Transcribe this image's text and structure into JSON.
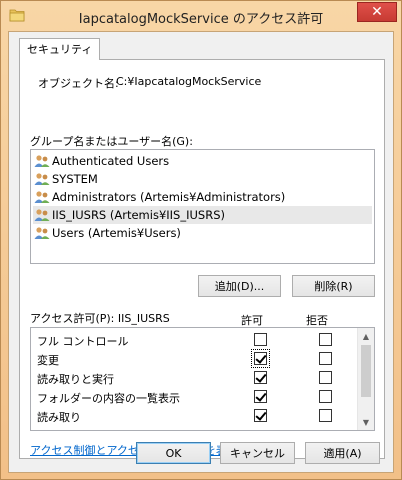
{
  "window": {
    "title": "IapcatalogMockService のアクセス許可",
    "close_label": "✕"
  },
  "tab": {
    "label": "セキュリティ"
  },
  "object": {
    "label": "オブジェクト名:",
    "value": "C:¥IapcatalogMockService"
  },
  "groups": {
    "label": "グループ名またはユーザー名(G):",
    "items": [
      {
        "label": "Authenticated Users",
        "selected": false
      },
      {
        "label": "SYSTEM",
        "selected": false
      },
      {
        "label": "Administrators (Artemis¥Administrators)",
        "selected": false
      },
      {
        "label": "IIS_IUSRS (Artemis¥IIS_IUSRS)",
        "selected": true
      },
      {
        "label": "Users (Artemis¥Users)",
        "selected": false
      }
    ],
    "add_label": "追加(D)...",
    "remove_label": "削除(R)"
  },
  "permissions": {
    "label": "アクセス許可(P): IIS_IUSRS",
    "allow_header": "許可",
    "deny_header": "拒否",
    "rows": [
      {
        "name": "フル コントロール",
        "allow": false,
        "deny": false
      },
      {
        "name": "変更",
        "allow": true,
        "deny": false,
        "focus": true
      },
      {
        "name": "読み取りと実行",
        "allow": true,
        "deny": false
      },
      {
        "name": "フォルダーの内容の一覧表示",
        "allow": true,
        "deny": false
      },
      {
        "name": "読み取り",
        "allow": true,
        "deny": false
      }
    ]
  },
  "link": {
    "label": "アクセス制御とアクセス許可の詳細を表示します。"
  },
  "footer": {
    "ok_label": "OK",
    "cancel_label": "キャンセル",
    "apply_label": "適用(A)"
  },
  "colors": {
    "accent": "#3c7fb1",
    "link": "#0066cc",
    "frame": "#f2c088"
  }
}
